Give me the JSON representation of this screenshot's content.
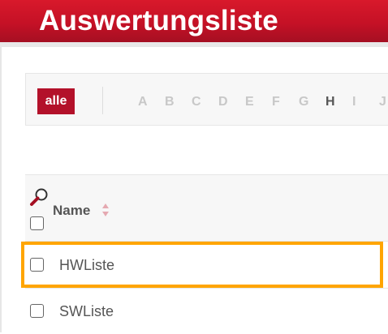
{
  "header": {
    "title": "Auswertungsliste"
  },
  "filter": {
    "all_label": "alle",
    "letters": [
      "A",
      "B",
      "C",
      "D",
      "E",
      "F",
      "G",
      "H",
      "I",
      "J"
    ],
    "active_letter": "H"
  },
  "table": {
    "column_name": "Name",
    "rows": [
      {
        "label": "HWListe",
        "highlighted": true
      },
      {
        "label": "SWListe",
        "highlighted": false
      }
    ]
  },
  "colors": {
    "header_red": "#c51126",
    "button_red": "#b3112a",
    "highlight_orange": "#ffa500"
  },
  "icons": [
    "search-icon",
    "sort-icon",
    "checkbox-icon"
  ]
}
